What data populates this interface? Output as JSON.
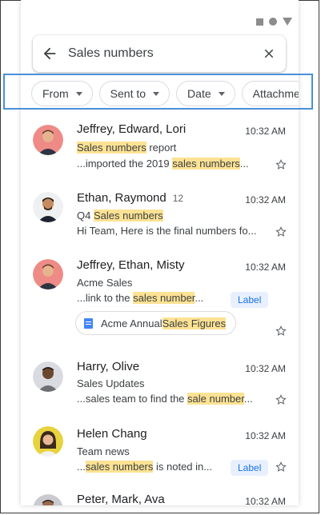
{
  "search": {
    "query": "Sales numbers"
  },
  "chips": [
    {
      "label": "From"
    },
    {
      "label": "Sent to"
    },
    {
      "label": "Date"
    },
    {
      "label": "Attachments"
    }
  ],
  "emails": [
    {
      "sender": "Jeffrey, Edward, Lori",
      "time": "10:32 AM",
      "subject": {
        "pre": "",
        "hl": "Sales numbers",
        "post": " report"
      },
      "snippet": {
        "pre": "...imported the 2019 ",
        "hl": "sales numbers",
        "post": "..."
      }
    },
    {
      "sender": "Ethan, Raymond",
      "count": "12",
      "time": "10:32 AM",
      "subject": {
        "pre": "Q4 ",
        "hl": "Sales numbers",
        "post": ""
      },
      "snippet": {
        "pre": "Hi Team, Here is the final numbers fo...",
        "hl": "",
        "post": ""
      }
    },
    {
      "sender": "Jeffrey, Ethan, Misty",
      "time": "10:32 AM",
      "subject": {
        "pre": "Acme Sales",
        "hl": "",
        "post": ""
      },
      "snippet": {
        "pre": "...link to the ",
        "hl": "sales number",
        "post": "..."
      },
      "label": "Label",
      "attachment": {
        "pre": "Acme Annual ",
        "hl": "Sales Figures"
      }
    },
    {
      "sender": "Harry, Olive",
      "time": "10:32 AM",
      "subject": {
        "pre": "Sales Updates",
        "hl": "",
        "post": ""
      },
      "snippet": {
        "pre": "...sales team to find the ",
        "hl": "sale number",
        "post": "..."
      }
    },
    {
      "sender": "Helen Chang",
      "time": "10:32 AM",
      "subject": {
        "pre": "Team news",
        "hl": "",
        "post": ""
      },
      "snippet": {
        "pre": "...",
        "hl": "sales numbers",
        "post": " is noted in..."
      },
      "label": "Label"
    },
    {
      "sender": "Peter, Mark, Ava",
      "time": "10:32 AM"
    }
  ],
  "colors": {
    "highlight": "#fde293",
    "accent": "#1a73e8",
    "selection_box": "#4a90d9"
  }
}
